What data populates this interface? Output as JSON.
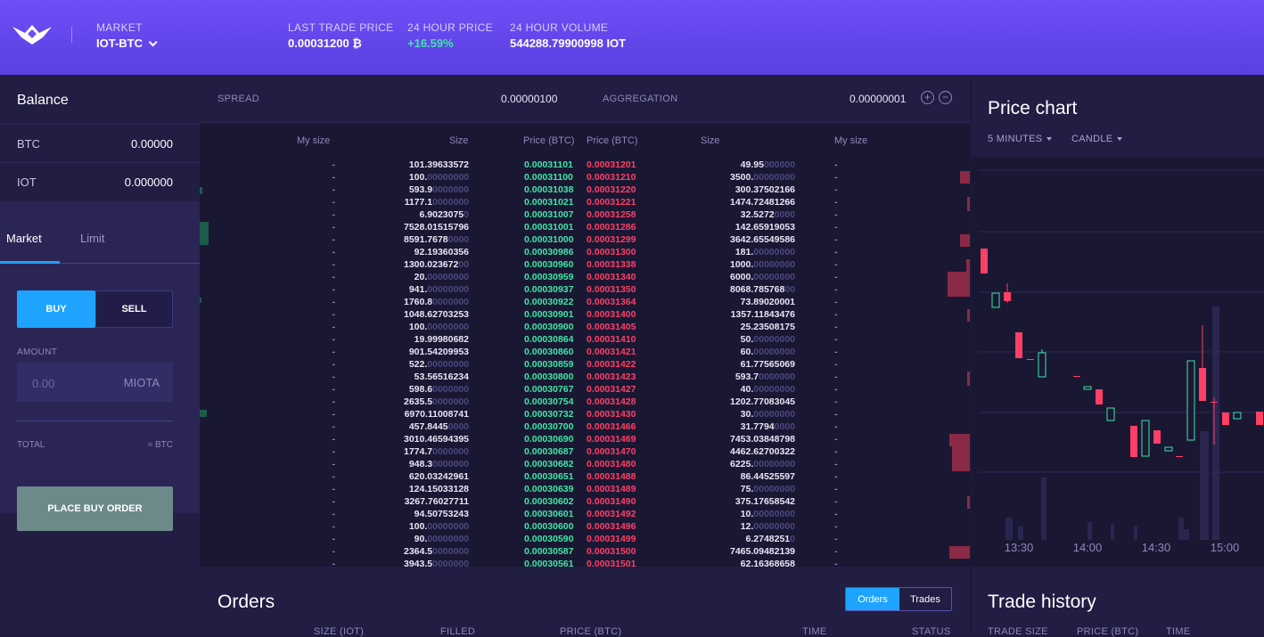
{
  "header": {
    "market_label": "MARKET",
    "market_value": "IOT-BTC",
    "last_trade_label": "LAST TRADE PRICE",
    "last_trade_value": "0.00031200 ₿",
    "change_label": "24 HOUR PRICE",
    "change_value": "+16.59%",
    "volume_label": "24 HOUR VOLUME",
    "volume_value": "544288.79900998 IOT"
  },
  "balance": {
    "title": "Balance",
    "rows": [
      {
        "currency": "BTC",
        "amount": "0.00000"
      },
      {
        "currency": "IOT",
        "amount": "0.000000"
      }
    ]
  },
  "form": {
    "tab_market": "Market",
    "tab_limit": "Limit",
    "buy": "BUY",
    "sell": "SELL",
    "amount_label": "AMOUNT",
    "amount_placeholder": "0.00",
    "amount_unit": "MIOTA",
    "total_label": "TOTAL",
    "total_unit": "≈ BTC",
    "place_order": "PLACE BUY ORDER"
  },
  "orderbook": {
    "spread_label": "SPREAD",
    "spread_value": "0.00000100",
    "aggregation_label": "AGGREGATION",
    "aggregation_value": "0.00000001",
    "headers": {
      "my_size_bid": "My size",
      "size_bid": "Size",
      "price_bid": "Price (BTC)",
      "price_ask": "Price (BTC)",
      "size_ask": "Size",
      "my_size_ask": "My size"
    },
    "rows": [
      {
        "bs": "101.39633572",
        "bsd": "",
        "bp": "0.00031101",
        "ap": "0.00031201",
        "as": "49.95",
        "asd": "000000"
      },
      {
        "bs": "100.",
        "bsd": "00000000",
        "bp": "0.00031100",
        "ap": "0.00031210",
        "as": "3500.",
        "asd": "00000000"
      },
      {
        "bs": "593.9",
        "bsd": "0000000",
        "bp": "0.00031038",
        "ap": "0.00031220",
        "as": "300.37502166",
        "asd": ""
      },
      {
        "bs": "1177.1",
        "bsd": "0000000",
        "bp": "0.00031021",
        "ap": "0.00031221",
        "as": "1474.72481266",
        "asd": ""
      },
      {
        "bs": "6.9023075",
        "bsd": "0",
        "bp": "0.00031007",
        "ap": "0.00031258",
        "as": "32.5272",
        "asd": "0000"
      },
      {
        "bs": "7528.01515796",
        "bsd": "",
        "bp": "0.00031001",
        "ap": "0.00031286",
        "as": "142.65919053",
        "asd": ""
      },
      {
        "bs": "8591.7678",
        "bsd": "0000",
        "bp": "0.00031000",
        "ap": "0.00031299",
        "as": "3642.65549586",
        "asd": ""
      },
      {
        "bs": "92.19360356",
        "bsd": "",
        "bp": "0.00030986",
        "ap": "0.00031300",
        "as": "181.",
        "asd": "00000000"
      },
      {
        "bs": "1300.023672",
        "bsd": "00",
        "bp": "0.00030960",
        "ap": "0.00031338",
        "as": "1000.",
        "asd": "00000000"
      },
      {
        "bs": "20.",
        "bsd": "00000000",
        "bp": "0.00030959",
        "ap": "0.00031340",
        "as": "6000.",
        "asd": "00000000"
      },
      {
        "bs": "941.",
        "bsd": "00000000",
        "bp": "0.00030937",
        "ap": "0.00031350",
        "as": "8068.785768",
        "asd": "00"
      },
      {
        "bs": "1760.8",
        "bsd": "0000000",
        "bp": "0.00030922",
        "ap": "0.00031364",
        "as": "73.89020001",
        "asd": ""
      },
      {
        "bs": "1048.62703253",
        "bsd": "",
        "bp": "0.00030901",
        "ap": "0.00031400",
        "as": "1357.11843476",
        "asd": ""
      },
      {
        "bs": "100.",
        "bsd": "00000000",
        "bp": "0.00030900",
        "ap": "0.00031405",
        "as": "25.23508175",
        "asd": ""
      },
      {
        "bs": "19.99980682",
        "bsd": "",
        "bp": "0.00030864",
        "ap": "0.00031410",
        "as": "50.",
        "asd": "00000000"
      },
      {
        "bs": "901.54209953",
        "bsd": "",
        "bp": "0.00030860",
        "ap": "0.00031421",
        "as": "60.",
        "asd": "00000000"
      },
      {
        "bs": "522.",
        "bsd": "00000000",
        "bp": "0.00030859",
        "ap": "0.00031422",
        "as": "61.77565069",
        "asd": ""
      },
      {
        "bs": "53.56516234",
        "bsd": "",
        "bp": "0.00030800",
        "ap": "0.00031423",
        "as": "593.7",
        "asd": "0000000"
      },
      {
        "bs": "598.6",
        "bsd": "0000000",
        "bp": "0.00030767",
        "ap": "0.00031427",
        "as": "40.",
        "asd": "00000000"
      },
      {
        "bs": "2635.5",
        "bsd": "0000000",
        "bp": "0.00030754",
        "ap": "0.00031428",
        "as": "1202.77083045",
        "asd": ""
      },
      {
        "bs": "6970.11008741",
        "bsd": "",
        "bp": "0.00030732",
        "ap": "0.00031430",
        "as": "30.",
        "asd": "00000000"
      },
      {
        "bs": "457.8445",
        "bsd": "0000",
        "bp": "0.00030700",
        "ap": "0.00031466",
        "as": "31.7794",
        "asd": "0000"
      },
      {
        "bs": "3010.46594395",
        "bsd": "",
        "bp": "0.00030690",
        "ap": "0.00031469",
        "as": "7453.03848798",
        "asd": ""
      },
      {
        "bs": "1774.7",
        "bsd": "0000000",
        "bp": "0.00030687",
        "ap": "0.00031470",
        "as": "4462.62700322",
        "asd": ""
      },
      {
        "bs": "948.3",
        "bsd": "0000000",
        "bp": "0.00030682",
        "ap": "0.00031480",
        "as": "6225.",
        "asd": "00000000"
      },
      {
        "bs": "620.03242961",
        "bsd": "",
        "bp": "0.00030651",
        "ap": "0.00031488",
        "as": "86.44525597",
        "asd": ""
      },
      {
        "bs": "124.15033128",
        "bsd": "",
        "bp": "0.00030639",
        "ap": "0.00031489",
        "as": "75.",
        "asd": "00000000"
      },
      {
        "bs": "3267.76027711",
        "bsd": "",
        "bp": "0.00030602",
        "ap": "0.00031490",
        "as": "375.17658542",
        "asd": ""
      },
      {
        "bs": "94.50753243",
        "bsd": "",
        "bp": "0.00030601",
        "ap": "0.00031492",
        "as": "10.",
        "asd": "00000000"
      },
      {
        "bs": "100.",
        "bsd": "00000000",
        "bp": "0.00030600",
        "ap": "0.00031496",
        "as": "12.",
        "asd": "00000000"
      },
      {
        "bs": "90.",
        "bsd": "00000000",
        "bp": "0.00030590",
        "ap": "0.00031499",
        "as": "6.2748251",
        "asd": "0"
      },
      {
        "bs": "2364.5",
        "bsd": "0000000",
        "bp": "0.00030587",
        "ap": "0.00031500",
        "as": "7465.09482139",
        "asd": ""
      },
      {
        "bs": "3943.5",
        "bsd": "0000000",
        "bp": "0.00030561",
        "ap": "0.00031501",
        "as": "62.16368658",
        "asd": ""
      }
    ],
    "my_size_placeholder": "-"
  },
  "chart": {
    "title": "Price chart",
    "interval": "5 MINUTES",
    "type_selector": "CANDLE",
    "x_ticks": [
      "13:30",
      "14:00",
      "14:30",
      "15:00"
    ],
    "colors": {
      "up": "#3fe6a6",
      "down": "#ff3f66"
    }
  },
  "orders": {
    "title": "Orders",
    "toggle_orders": "Orders",
    "toggle_trades": "Trades",
    "headers": [
      "SIZE (IOT)",
      "FILLED",
      "PRICE (BTC)",
      "TIME",
      "STATUS"
    ]
  },
  "history": {
    "title": "Trade history",
    "headers": [
      "TRADE SIZE",
      "PRICE (BTC)",
      "TIME"
    ]
  }
}
